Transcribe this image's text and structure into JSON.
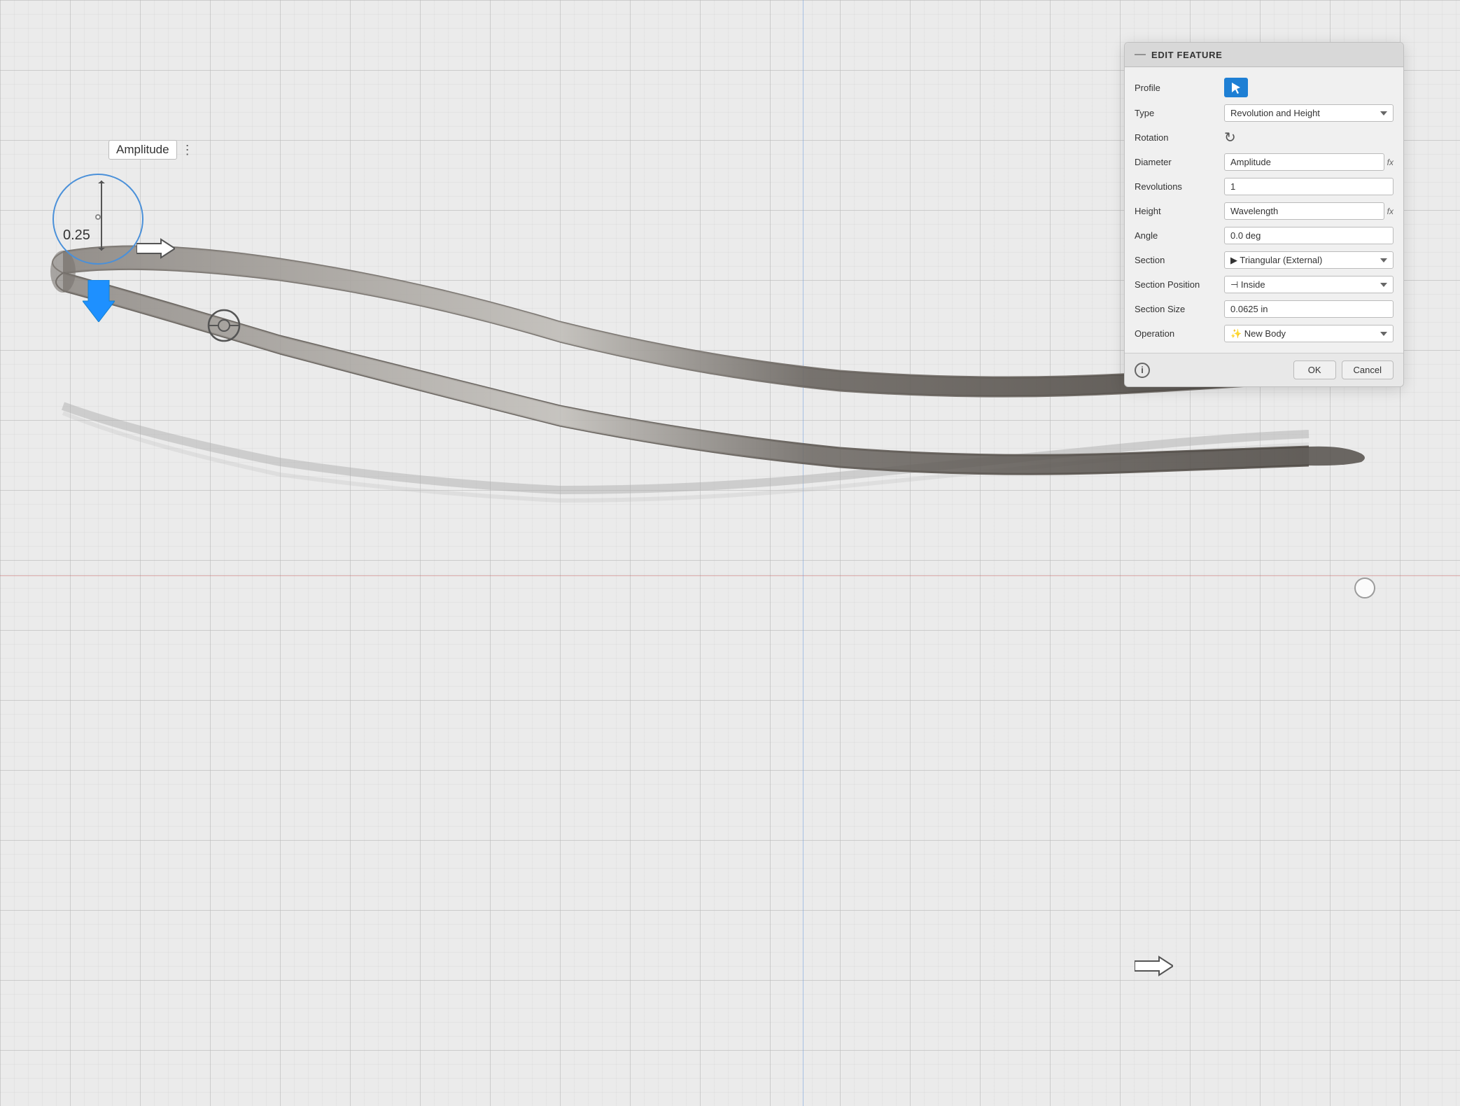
{
  "viewport": {
    "background": "#ebebeb"
  },
  "dimension": {
    "value": "0.25"
  },
  "amplitude_label": {
    "text": "Amplitude",
    "dots": "⋮"
  },
  "panel": {
    "header": {
      "icon": "—",
      "title": "EDIT FEATURE"
    },
    "rows": [
      {
        "label": "Profile",
        "type": "profile-btn",
        "value": ""
      },
      {
        "label": "Type",
        "type": "select",
        "value": "Revolution and Height"
      },
      {
        "label": "Rotation",
        "type": "rotation-icon",
        "value": ""
      },
      {
        "label": "Diameter",
        "type": "input-fx",
        "value": "Amplitude"
      },
      {
        "label": "Revolutions",
        "type": "input",
        "value": "1"
      },
      {
        "label": "Height",
        "type": "input-fx",
        "value": "Wavelength"
      },
      {
        "label": "Angle",
        "type": "input",
        "value": "0.0 deg"
      },
      {
        "label": "Section",
        "type": "select",
        "value": "Triangular (External)"
      },
      {
        "label": "Section Position",
        "type": "select",
        "value": "Inside"
      },
      {
        "label": "Section Size",
        "type": "input",
        "value": "0.0625 in"
      },
      {
        "label": "Operation",
        "type": "select",
        "value": "New Body"
      }
    ],
    "footer": {
      "info": "i",
      "ok": "OK",
      "cancel": "Cancel"
    }
  }
}
